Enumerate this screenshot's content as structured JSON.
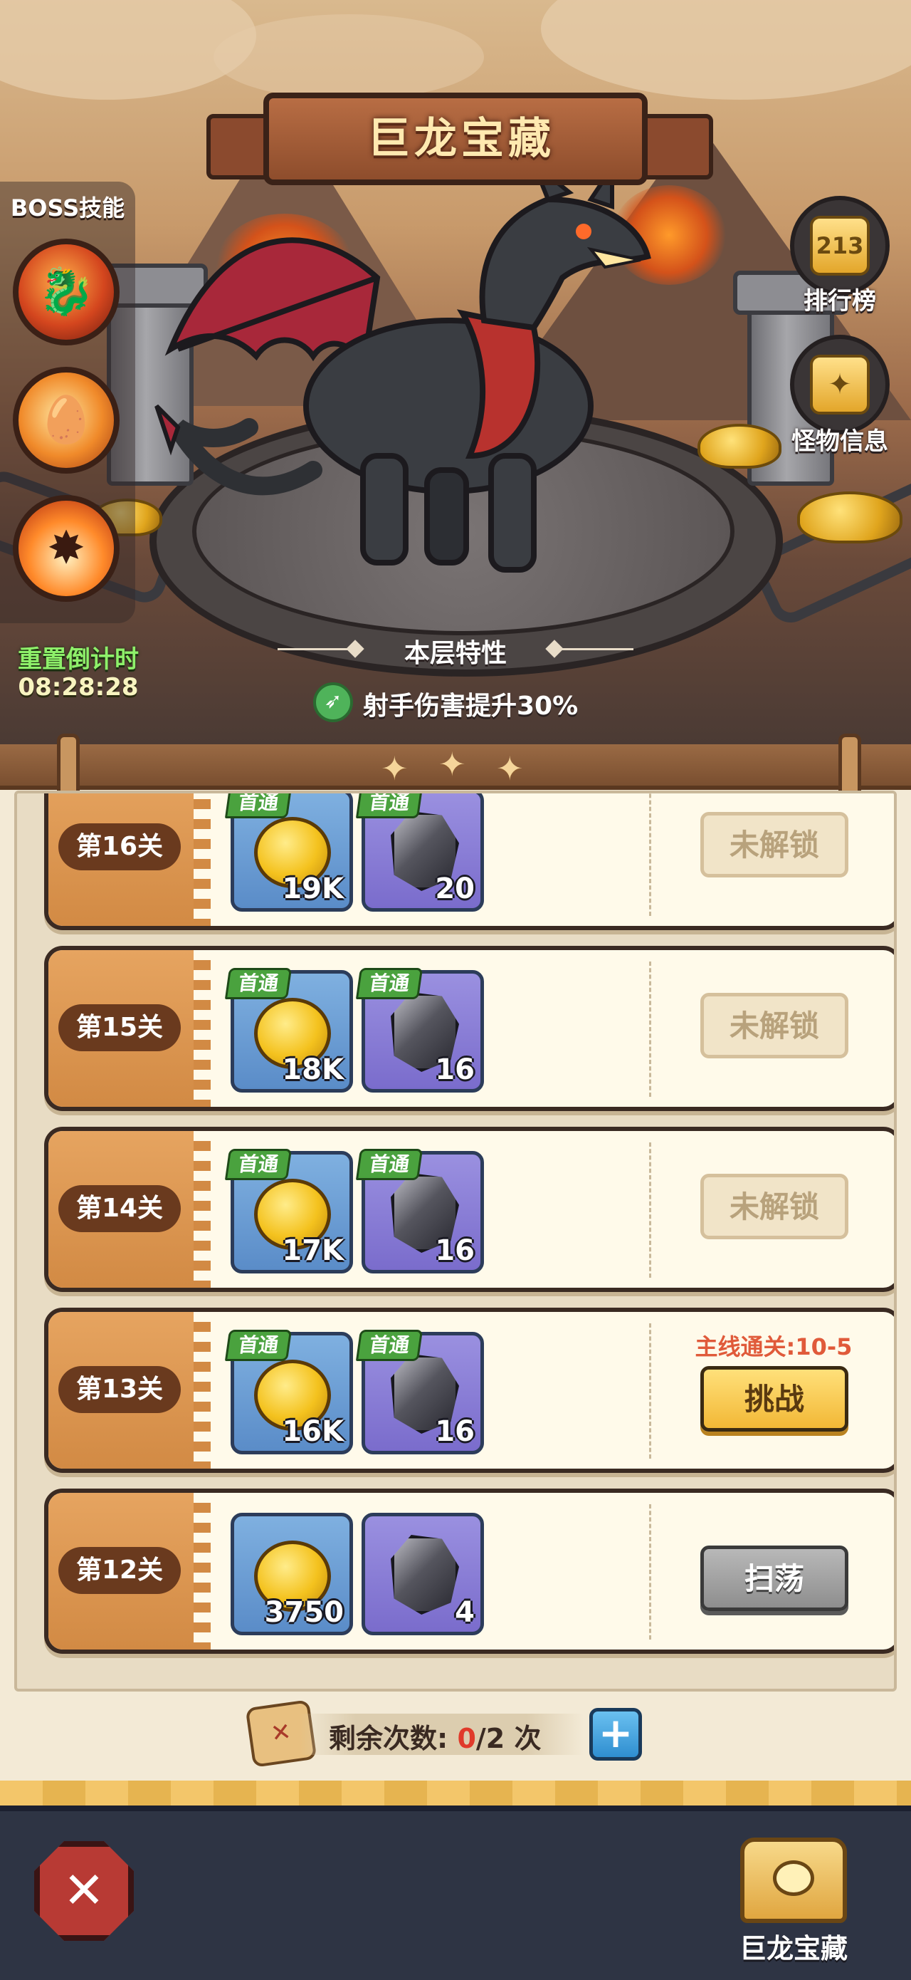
{
  "title": "巨龙宝藏",
  "boss_skills": {
    "title": "BOSS技能",
    "skills": [
      {
        "icon": "dragon-fire-skill-icon"
      },
      {
        "icon": "egg-fire-skill-icon"
      },
      {
        "icon": "explosion-skill-icon"
      }
    ]
  },
  "reset": {
    "label": "重置倒计时",
    "time": "08:28:28"
  },
  "side_buttons": [
    {
      "label": "排行榜",
      "icon": "podium-icon",
      "glyph": "213"
    },
    {
      "label": "怪物信息",
      "icon": "monster-book-icon",
      "glyph": "✦"
    }
  ],
  "floor_trait": {
    "title": "本层特性",
    "description": "射手伤害提升30%",
    "icon": "archer-bow-icon"
  },
  "first_clear_tag": "首通",
  "levels": [
    {
      "name": "第16关",
      "gold": "19K",
      "ore": "20",
      "first_clear": true,
      "button": "未解锁",
      "state": "locked",
      "requirement": ""
    },
    {
      "name": "第15关",
      "gold": "18K",
      "ore": "16",
      "first_clear": true,
      "button": "未解锁",
      "state": "locked",
      "requirement": ""
    },
    {
      "name": "第14关",
      "gold": "17K",
      "ore": "16",
      "first_clear": true,
      "button": "未解锁",
      "state": "locked",
      "requirement": ""
    },
    {
      "name": "第13关",
      "gold": "16K",
      "ore": "16",
      "first_clear": true,
      "button": "挑战",
      "state": "challenge",
      "requirement": "主线通关:10-5"
    },
    {
      "name": "第12关",
      "gold": "3750",
      "ore": "4",
      "first_clear": false,
      "button": "扫荡",
      "state": "sweep",
      "requirement": ""
    }
  ],
  "attempts": {
    "label": "剩余次数:",
    "used": "0",
    "total": "/2",
    "unit": "次",
    "plus": "+"
  },
  "bottom_nav": {
    "close_glyph": "✕",
    "tab_label": "巨龙宝藏"
  },
  "colors": {
    "gold_reward_bg": "#5a8cc8",
    "ore_reward_bg": "#7a6ccc",
    "first_clear_tag": "#4aa23e",
    "requirement_text": "#e05a3a",
    "challenge_button": "#f2b836"
  }
}
